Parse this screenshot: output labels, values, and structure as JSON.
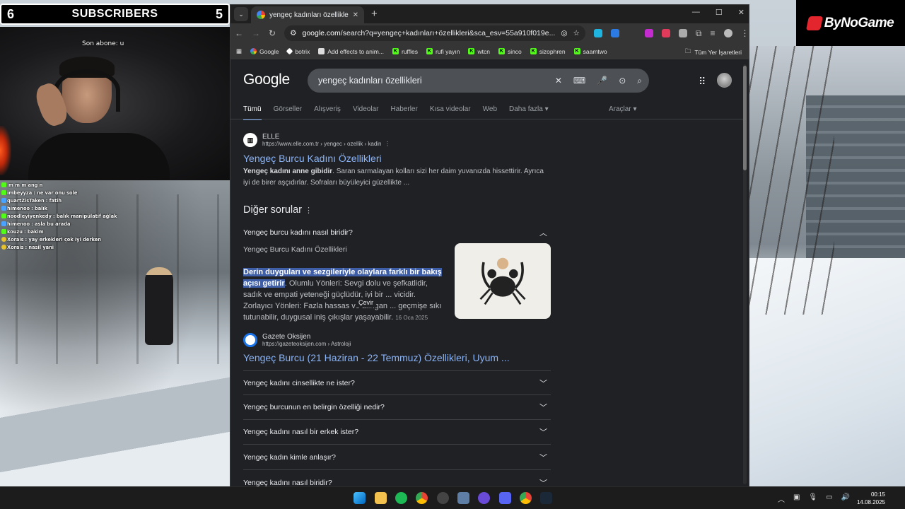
{
  "overlay": {
    "subs_left": "6",
    "subs_label": "SUBSCRIBERS",
    "subs_right": "5",
    "son_abone": "Son abone: u",
    "chat": [
      {
        "user": "",
        "text": "m m m ang n",
        "badge": "g"
      },
      {
        "user": "imbeyyza",
        "text": ": ne var onu sole",
        "badge": "g"
      },
      {
        "user": "quartZisTaken",
        "text": ": fatih",
        "badge": "b"
      },
      {
        "user": "himenoo",
        "text": ": balık",
        "badge": "b"
      },
      {
        "user": "noodleyiyenkedy",
        "text": ": balık manipülatif ağlak",
        "badge": "g"
      },
      {
        "user": "himenoo",
        "text": ": asla bu arada",
        "badge": "b"
      },
      {
        "user": "kouzu",
        "text": ": bakim",
        "badge": "g"
      },
      {
        "user": "Xorais",
        "text": ": yay erkekleri çok iyi derken",
        "badge": "y"
      },
      {
        "user": "Xorais",
        "text": ": nasil yani",
        "badge": "y"
      }
    ],
    "logo": "ByNoGame"
  },
  "browser": {
    "tab_title": "yengeç kadınları özellikleri - Go",
    "url_domain": "google.com",
    "url_rest": "/search?q=yengeç+kadınları+özellikleri&sca_esv=55a910f019e...",
    "bookmarks": [
      {
        "label": "Google",
        "icon": "google"
      },
      {
        "label": "botrix",
        "icon": "botrix"
      },
      {
        "label": "Add effects to anim...",
        "icon": "app"
      },
      {
        "label": "ruffles",
        "icon": "kick"
      },
      {
        "label": "rufi yayın",
        "icon": "kick"
      },
      {
        "label": "wtcn",
        "icon": "kick"
      },
      {
        "label": "sinco",
        "icon": "kick"
      },
      {
        "label": "sizophren",
        "icon": "kick"
      },
      {
        "label": "saamtwo",
        "icon": "kick"
      }
    ],
    "all_bookmarks": "Tüm Yer İşaretleri"
  },
  "google": {
    "logo": "Google",
    "query": "yengeç kadınları özellikleri",
    "tabs": [
      "Tümü",
      "Görseller",
      "Alışveriş",
      "Videolar",
      "Haberler",
      "Kısa videolar",
      "Web",
      "Daha fazla"
    ],
    "tools": "Araçlar",
    "result1": {
      "site": "ELLE",
      "crumb": "https://www.elle.com.tr › yengec › ozellik › kadin",
      "title": "Yengeç Burcu Kadını Özellikleri",
      "snippet_bold": "Yengeç kadını anne gibidir",
      "snippet": ". Saran sarmalayan kolları sizi her daim yuvanızda hissettirir. Ayrıca iyi de birer aşçıdırlar. Sofraları büyüleyici güzellikte ..."
    },
    "paa_title": "Diğer sorular",
    "paa_open": {
      "question": "Yengeç burcu kadını nasıl biridir?",
      "sub": "Yengeç Burcu Kadını Özellikleri",
      "highlight": "Derin duyguları ve sezgileriyle olaylara farklı bir bakış açısı getirir",
      "answer": ". Olumlu Yönleri: Sevgi dolu ve şefkatlidir, sadık ve empati yeteneği güçlüdür, iyi bir ... vicidir. Zorlayıcı Yönleri: Fazla hassas ve alıngan ... geçmişe sıkı tutunabilir, duygusal iniş çıkışlar yaşayabilir.",
      "date": "16 Oca 2025",
      "tooltip": "Çevir",
      "source_name": "Gazete Oksijen",
      "source_crumb": "https://gazeteoksijen.com › Astroloji",
      "source_title": "Yengeç Burcu (21 Haziran - 22 Temmuz) Özellikleri, Uyum ..."
    },
    "paa_questions": [
      "Yengeç kadını cinsellikte ne ister?",
      "Yengeç burcunun en belirgin özelliği nedir?",
      "Yengeç kadını nasıl bir erkek ister?",
      "Yengeç kadın kimle anlaşır?",
      "Yengeç kadını nasıl biridir?"
    ]
  },
  "taskbar": {
    "time": "00:15",
    "date": "14.08.2025"
  }
}
